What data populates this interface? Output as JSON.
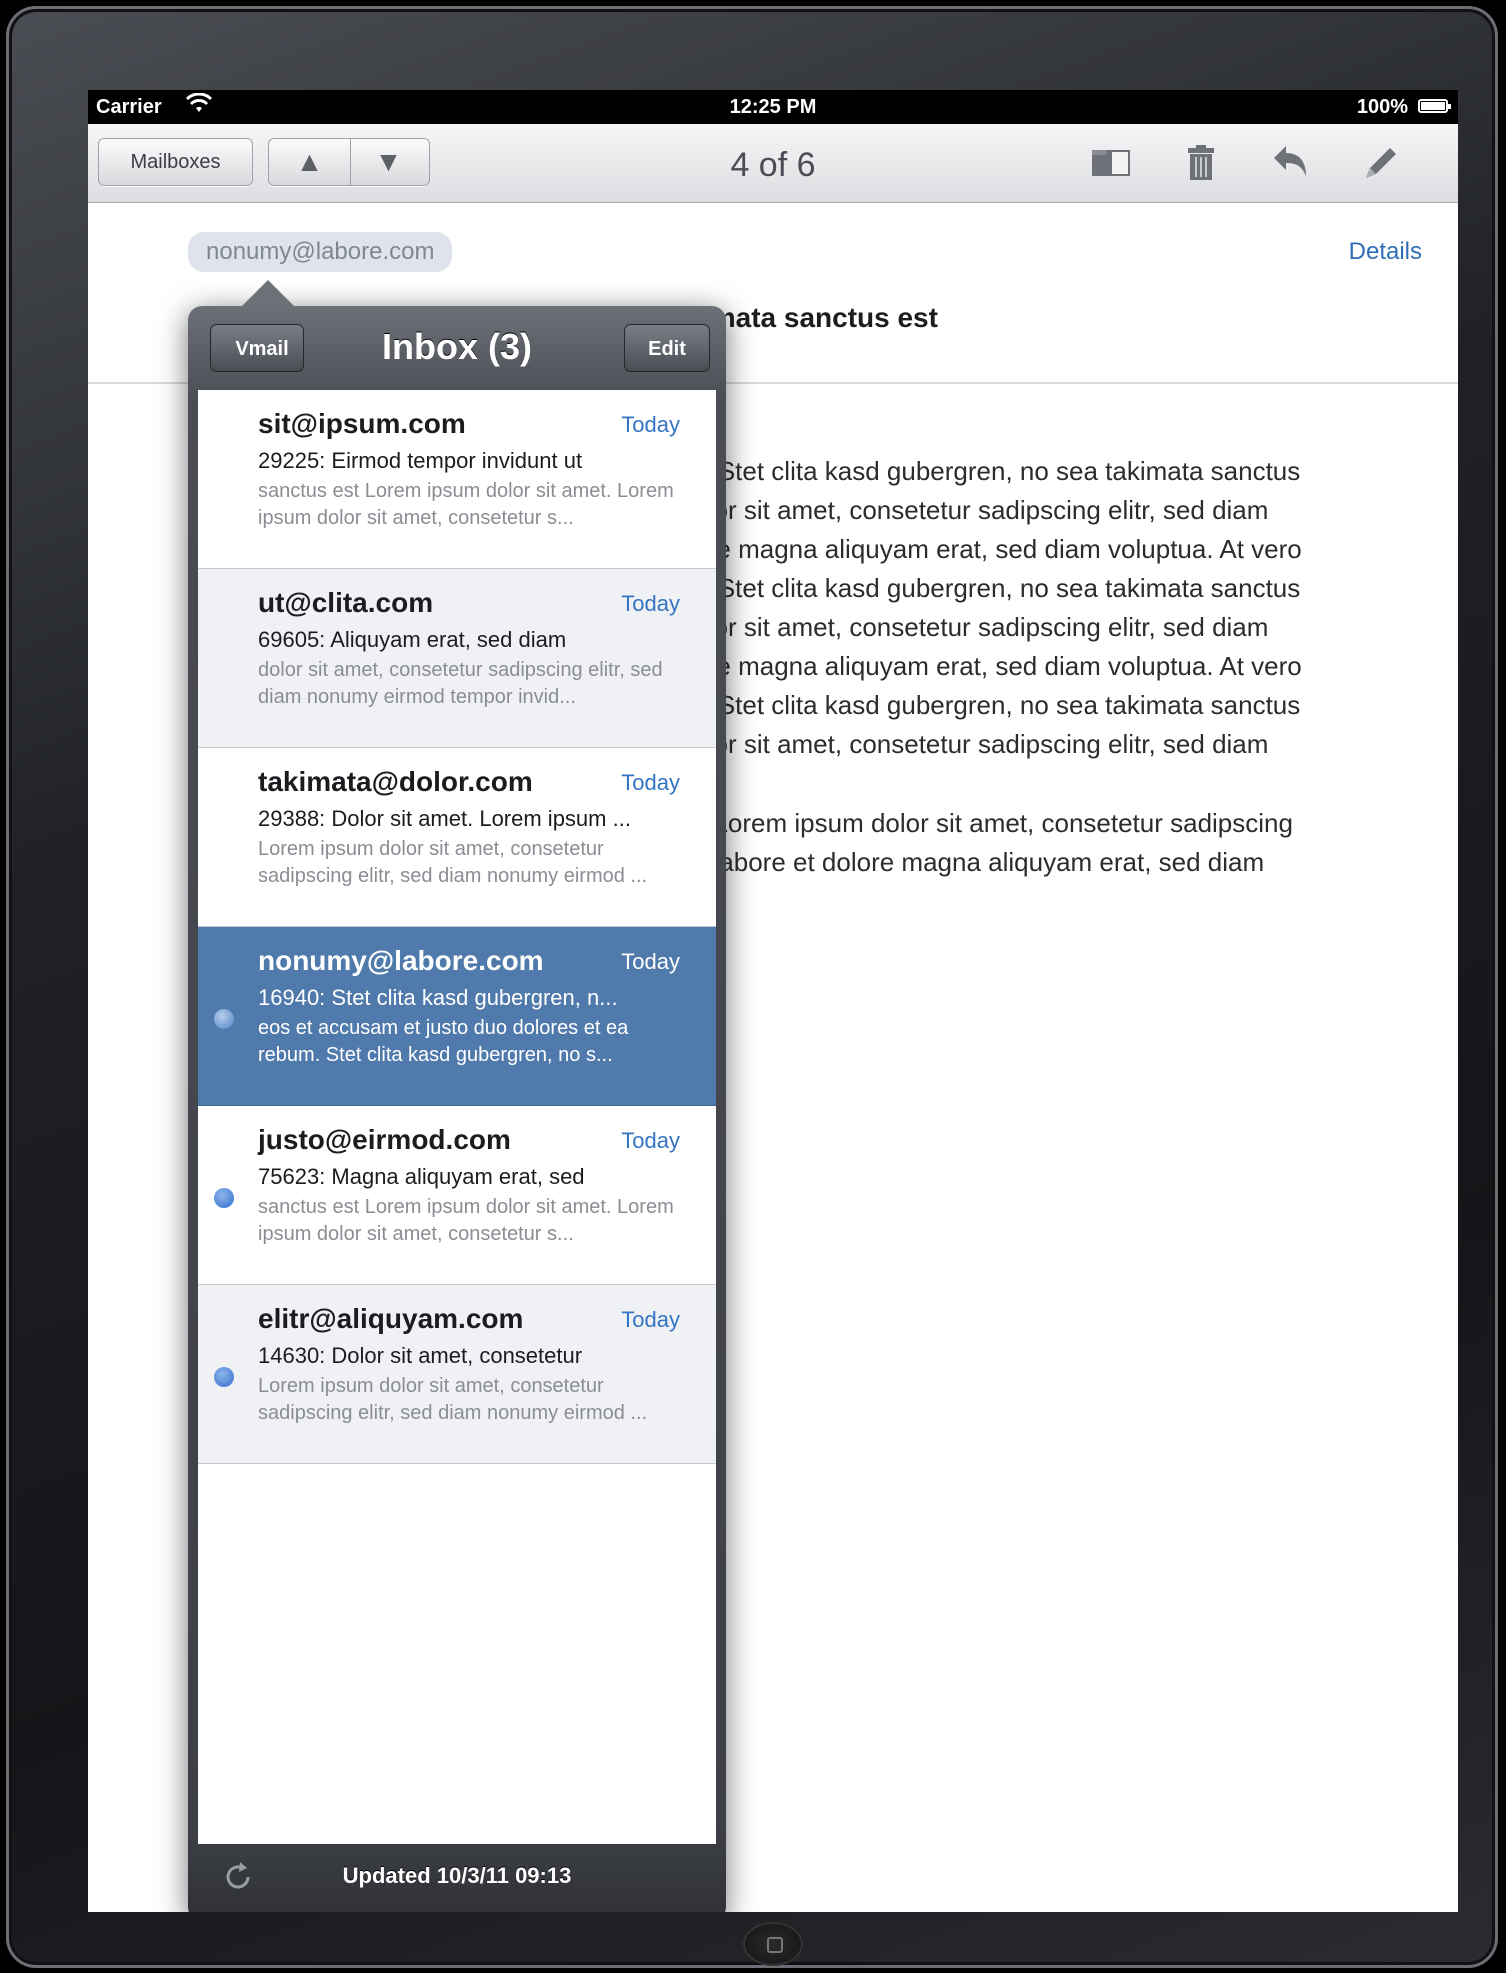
{
  "status_bar": {
    "carrier": "Carrier",
    "time": "12:25 PM",
    "battery": "100%"
  },
  "toolbar": {
    "mailboxes_label": "Mailboxes",
    "message_counter": "4 of 6",
    "icons": [
      "folder-icon",
      "trash-icon",
      "reply-icon",
      "compose-icon"
    ]
  },
  "message": {
    "from_chip": "nonumy@labore.com",
    "details_label": "Details",
    "subject": "sea takimata sanctus est",
    "body_lines": [
      "a rebum. Stet clita kasd gubergren, no sea takimata sanctus",
      "psum dolor sit amet, consetetur sadipscing elitr, sed diam",
      "e et dolore magna aliquyam erat, sed diam voluptua. At vero",
      "a rebum. Stet clita kasd gubergren, no sea takimata sanctus",
      "psum dolor sit amet, consetetur sadipscing elitr, sed diam",
      "e et dolore magna aliquyam erat, sed diam voluptua. At vero",
      "a rebum. Stet clita kasd gubergren, no sea takimata sanctus",
      "psum dolor sit amet, consetetur sadipscing elitr, sed diam"
    ],
    "body_lines_2": [
      "sit amet. Lorem ipsum dolor sit amet, consetetur sadipscing",
      "vidunt ut labore et dolore magna aliquyam erat, sed diam"
    ]
  },
  "popover": {
    "back_label": "Vmail",
    "title": "Inbox (3)",
    "edit_label": "Edit",
    "updated_text": "Updated 10/3/11 09:13",
    "messages": [
      {
        "sender": "sit@ipsum.com",
        "date": "Today",
        "subject": "29225: Eirmod tempor invidunt ut",
        "preview": "sanctus est Lorem ipsum dolor sit amet. Lorem ipsum dolor sit amet, consetetur s...",
        "unread": false,
        "selected": false
      },
      {
        "sender": "ut@clita.com",
        "date": "Today",
        "subject": "69605: Aliquyam erat, sed diam",
        "preview": "dolor sit amet, consetetur sadipscing elitr, sed diam nonumy eirmod tempor invid...",
        "unread": false,
        "selected": false
      },
      {
        "sender": "takimata@dolor.com",
        "date": "Today",
        "subject": "29388: Dolor sit amet. Lorem ipsum ...",
        "preview": "Lorem ipsum dolor sit amet, consetetur sadipscing elitr, sed diam nonumy eirmod ...",
        "unread": false,
        "selected": false
      },
      {
        "sender": "nonumy@labore.com",
        "date": "Today",
        "subject": "16940: Stet clita kasd gubergren, n...",
        "preview": "eos et accusam et justo duo dolores et ea rebum. Stet clita kasd gubergren, no s...",
        "unread": true,
        "selected": true
      },
      {
        "sender": "justo@eirmod.com",
        "date": "Today",
        "subject": "75623: Magna aliquyam erat, sed",
        "preview": "sanctus est Lorem ipsum dolor sit amet. Lorem ipsum dolor sit amet, consetetur s...",
        "unread": true,
        "selected": false
      },
      {
        "sender": "elitr@aliquyam.com",
        "date": "Today",
        "subject": "14630: Dolor sit amet, consetetur",
        "preview": "Lorem ipsum dolor sit amet, consetetur sadipscing elitr, sed diam nonumy eirmod ...",
        "unread": true,
        "selected": false
      }
    ]
  },
  "colors": {
    "accent_blue": "#3474c4",
    "selected_row": "#4f7aab",
    "unread_dot": "#2f6ccd"
  }
}
